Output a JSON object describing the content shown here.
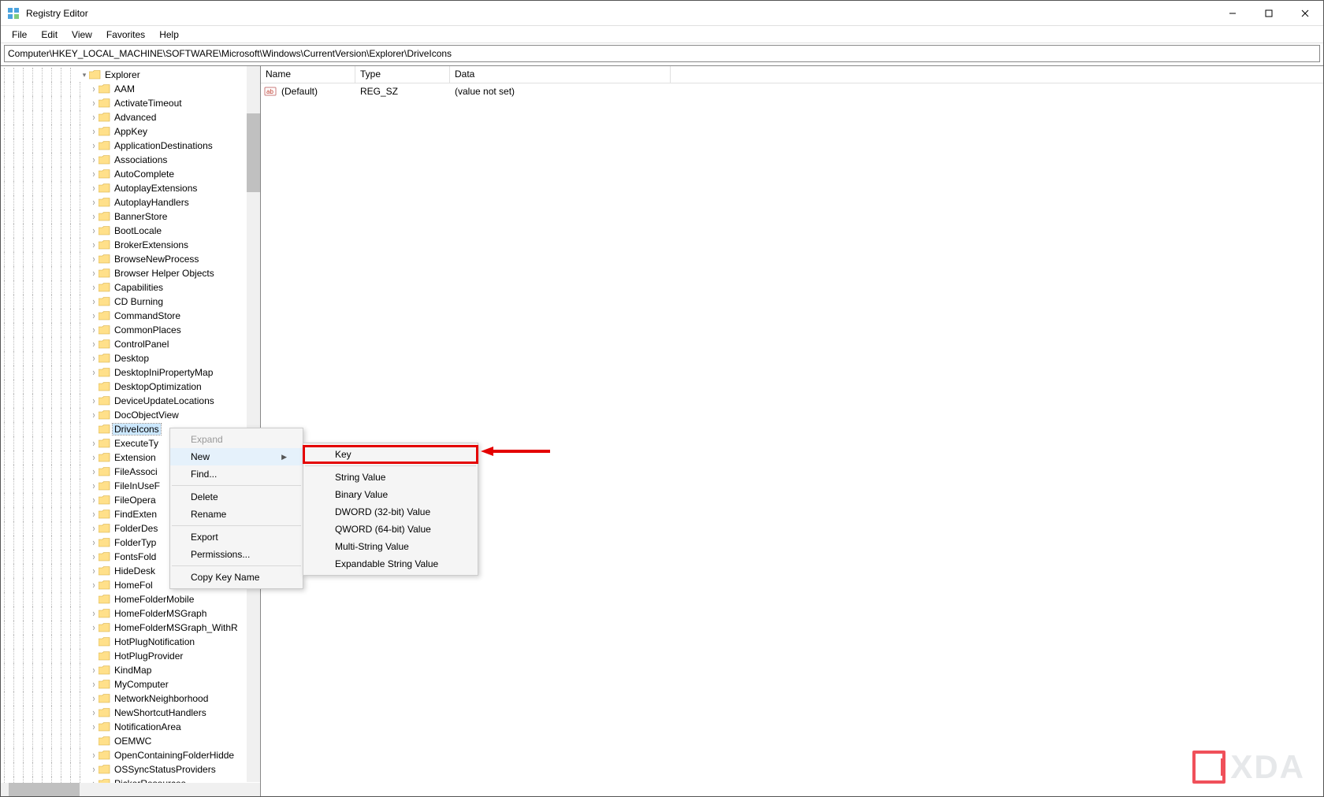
{
  "window": {
    "title": "Registry Editor"
  },
  "menu": {
    "items": [
      "File",
      "Edit",
      "View",
      "Favorites",
      "Help"
    ]
  },
  "address": {
    "path": "Computer\\HKEY_LOCAL_MACHINE\\SOFTWARE\\Microsoft\\Windows\\CurrentVersion\\Explorer\\DriveIcons"
  },
  "tree": {
    "parent": {
      "label": "Explorer",
      "expanded": true
    },
    "selected": "DriveIcons",
    "children": [
      "AAM",
      "ActivateTimeout",
      "Advanced",
      "AppKey",
      "ApplicationDestinations",
      "Associations",
      "AutoComplete",
      "AutoplayExtensions",
      "AutoplayHandlers",
      "BannerStore",
      "BootLocale",
      "BrokerExtensions",
      "BrowseNewProcess",
      "Browser Helper Objects",
      "Capabilities",
      "CD Burning",
      "CommandStore",
      "CommonPlaces",
      "ControlPanel",
      "Desktop",
      "DesktopIniPropertyMap",
      "DesktopOptimization",
      "DeviceUpdateLocations",
      "DocObjectView",
      "DriveIcons",
      "ExecuteTy",
      "Extension",
      "FileAssoci",
      "FileInUseF",
      "FileOpera",
      "FindExten",
      "FolderDes",
      "FolderTyp",
      "FontsFold",
      "HideDesk",
      "HomeFol",
      "HomeFolderMobile",
      "HomeFolderMSGraph",
      "HomeFolderMSGraph_WithR",
      "HotPlugNotification",
      "HotPlugProvider",
      "KindMap",
      "MyComputer",
      "NetworkNeighborhood",
      "NewShortcutHandlers",
      "NotificationArea",
      "OEMWC",
      "OpenContainingFolderHidde",
      "OSSyncStatusProviders",
      "PickerResources"
    ],
    "no_expand": [
      "DesktopOptimization",
      "DriveIcons",
      "HomeFolderMobile",
      "HotPlugNotification",
      "HotPlugProvider",
      "OEMWC"
    ]
  },
  "values": {
    "columns": {
      "name": "Name",
      "type": "Type",
      "data": "Data"
    },
    "rows": [
      {
        "name": "(Default)",
        "type": "REG_SZ",
        "data": "(value not set)"
      }
    ]
  },
  "context_menu": {
    "items": [
      {
        "label": "Expand",
        "disabled": true
      },
      {
        "label": "New",
        "submenu": true,
        "hover": true
      },
      {
        "label": "Find...",
        "sep_after": true
      },
      {
        "label": "Delete"
      },
      {
        "label": "Rename",
        "sep_after": true
      },
      {
        "label": "Export"
      },
      {
        "label": "Permissions...",
        "sep_after": true
      },
      {
        "label": "Copy Key Name"
      }
    ]
  },
  "sub_menu": {
    "items": [
      {
        "label": "Key",
        "highlight": true,
        "sep_after": true
      },
      {
        "label": "String Value"
      },
      {
        "label": "Binary Value"
      },
      {
        "label": "DWORD (32-bit) Value"
      },
      {
        "label": "QWORD (64-bit) Value"
      },
      {
        "label": "Multi-String Value"
      },
      {
        "label": "Expandable String Value"
      }
    ]
  },
  "watermark": {
    "text": "XDA"
  }
}
